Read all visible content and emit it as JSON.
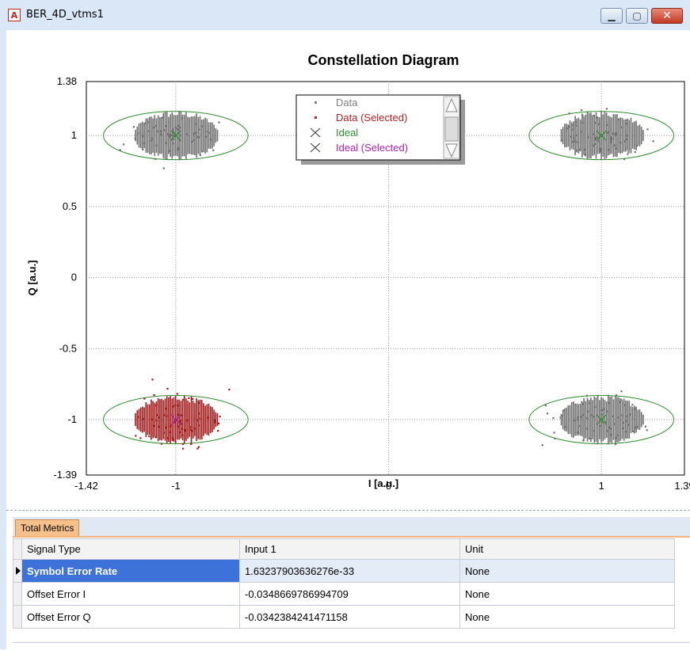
{
  "window": {
    "title": "BER_4D_vtms1",
    "app_icon_letter": "A"
  },
  "chart_data": {
    "type": "scatter",
    "title": "Constellation Diagram",
    "xlabel": "I [a.u.]",
    "ylabel": "Q [a.u.]",
    "xlim": [
      -1.42,
      1.39
    ],
    "ylim": [
      -1.39,
      1.38
    ],
    "x_ticks": [
      {
        "value": -1.42,
        "label": "-1.42"
      },
      {
        "value": -1,
        "label": "-1"
      },
      {
        "value": 0,
        "label": "0"
      },
      {
        "value": 1,
        "label": "1"
      },
      {
        "value": 1.39,
        "label": "1.39"
      }
    ],
    "y_ticks": [
      {
        "value": 1.38,
        "label": "1.38"
      },
      {
        "value": 1,
        "label": "1"
      },
      {
        "value": 0.5,
        "label": "0.5"
      },
      {
        "value": 0,
        "label": "0"
      },
      {
        "value": -0.5,
        "label": "-0.5"
      },
      {
        "value": -1,
        "label": "-1"
      },
      {
        "value": -1.39,
        "label": "-1.39"
      }
    ],
    "grid": true,
    "legend_position": "top-center",
    "legend": [
      {
        "label": "Data",
        "color": "#808080",
        "marker": "dot"
      },
      {
        "label": "Data (Selected)",
        "color": "#b22222",
        "marker": "dot"
      },
      {
        "label": "Ideal",
        "color": "#2e8b2e",
        "marker": "x"
      },
      {
        "label": "Ideal (Selected)",
        "color": "#aa22aa",
        "marker": "x"
      }
    ],
    "series": [
      {
        "name": "Ideal",
        "color": "#2e8b2e",
        "points": [
          [
            -1,
            1
          ],
          [
            1,
            1
          ],
          [
            1,
            -1
          ]
        ]
      },
      {
        "name": "Ideal (Selected)",
        "color": "#aa22aa",
        "points": [
          [
            -1,
            -1
          ]
        ]
      }
    ],
    "clusters": [
      {
        "series": "Data",
        "center": [
          -1,
          1
        ],
        "spread_x": 0.2,
        "spread_y": 0.17,
        "color": "#6e6e6e"
      },
      {
        "series": "Data",
        "center": [
          1,
          1
        ],
        "spread_x": 0.2,
        "spread_y": 0.17,
        "color": "#6e6e6e"
      },
      {
        "series": "Data",
        "center": [
          1,
          -1
        ],
        "spread_x": 0.2,
        "spread_y": 0.17,
        "color": "#6e6e6e"
      },
      {
        "series": "Data (Selected)",
        "center": [
          -1,
          -1
        ],
        "spread_x": 0.2,
        "spread_y": 0.17,
        "color": "#a01818"
      }
    ],
    "decision_ellipses": [
      {
        "center": [
          -1,
          1
        ],
        "rx": 0.34,
        "ry": 0.17
      },
      {
        "center": [
          1,
          1
        ],
        "rx": 0.34,
        "ry": 0.17
      },
      {
        "center": [
          -1,
          -1
        ],
        "rx": 0.34,
        "ry": 0.17
      },
      {
        "center": [
          1,
          -1
        ],
        "rx": 0.34,
        "ry": 0.17
      }
    ]
  },
  "metrics": {
    "tab_label": "Total Metrics",
    "columns": [
      "Signal Type",
      "Input 1",
      "Unit"
    ],
    "rows": [
      {
        "signal": "Symbol Error Rate",
        "value": "1.63237903636276e-33",
        "unit": "None",
        "selected": true
      },
      {
        "signal": "Offset Error I",
        "value": "-0.0348669786994709",
        "unit": "None",
        "selected": false
      },
      {
        "signal": "Offset Error Q",
        "value": "-0.0342384241471158",
        "unit": "None",
        "selected": false
      }
    ]
  },
  "legend_scroll": {
    "up_icon": "triangle-up-icon",
    "down_icon": "triangle-down-icon"
  },
  "colors": {
    "selected_cell": "#3d73d8",
    "tab_active": "#f6c08a",
    "ellipse": "#2e8b2e"
  }
}
